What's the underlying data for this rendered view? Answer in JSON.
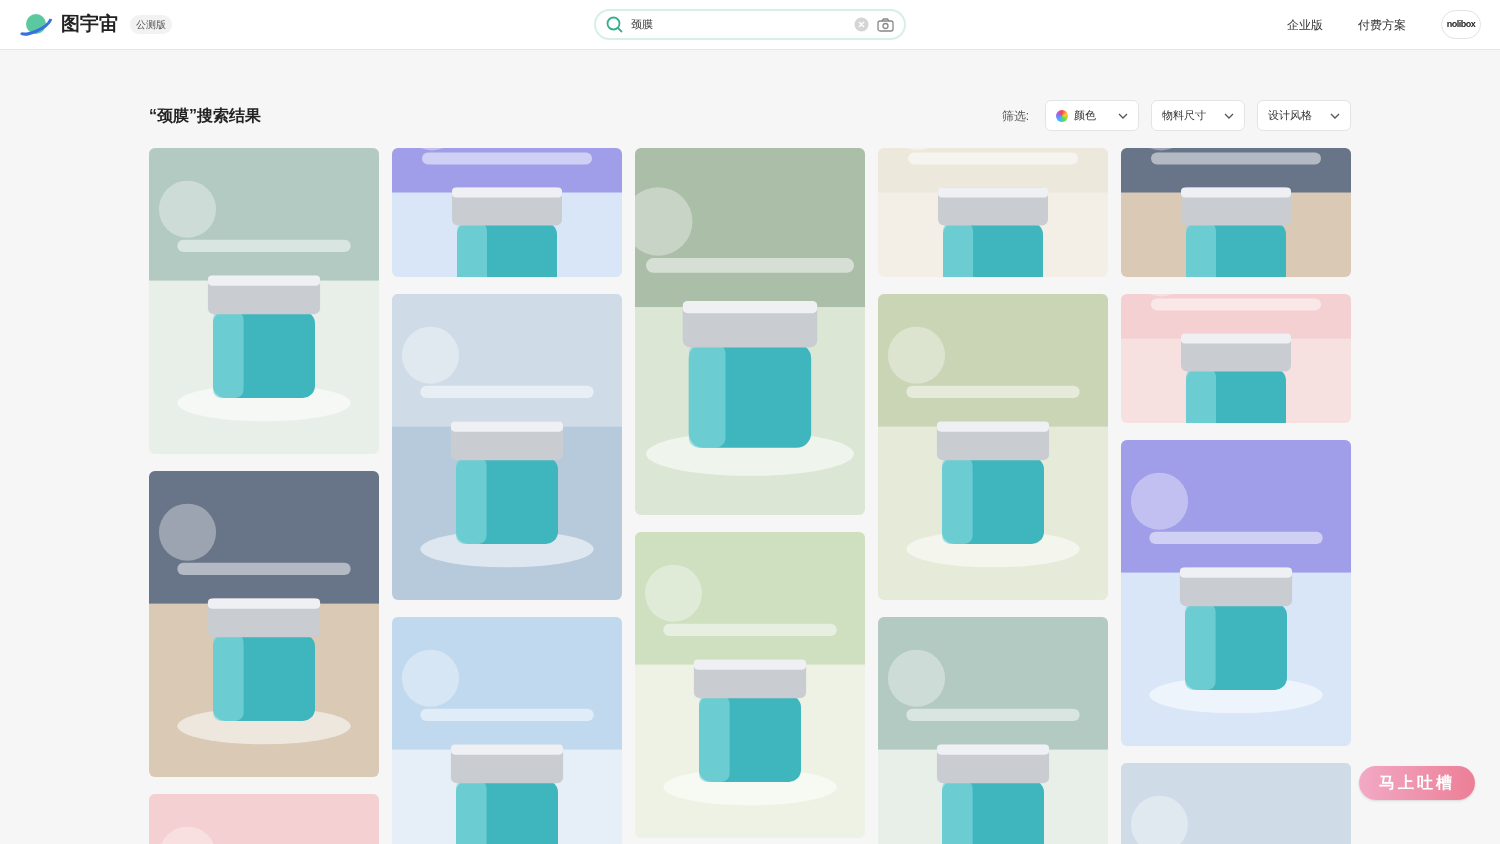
{
  "header": {
    "logo_text": "图宇宙",
    "badge": "公测版",
    "search": {
      "value": "颈膜"
    },
    "nav": [
      "企业版",
      "付费方案"
    ],
    "avatar_text": "nolibox"
  },
  "results_title": "“颈膜”搜索结果",
  "filter": {
    "label": "筛选:",
    "dropdowns": [
      {
        "label": "颜色",
        "kind": "color"
      },
      {
        "label": "物料尺寸",
        "kind": "plain"
      },
      {
        "label": "设计风格",
        "kind": "plain"
      }
    ]
  },
  "gallery": [
    [
      {
        "kind": "tall"
      },
      {
        "kind": "tall"
      },
      {
        "kind": "tall"
      }
    ],
    [
      {
        "kind": "short"
      },
      {
        "kind": "tall"
      },
      {
        "kind": "tall"
      }
    ],
    [
      {
        "kind": "long"
      },
      {
        "kind": "tall"
      }
    ],
    [
      {
        "kind": "short"
      },
      {
        "kind": "tall"
      },
      {
        "kind": "tall"
      }
    ],
    [
      {
        "kind": "short"
      },
      {
        "kind": "short"
      },
      {
        "kind": "tall"
      },
      {
        "kind": "tall"
      }
    ]
  ],
  "feedback_button": "马上吐槽"
}
